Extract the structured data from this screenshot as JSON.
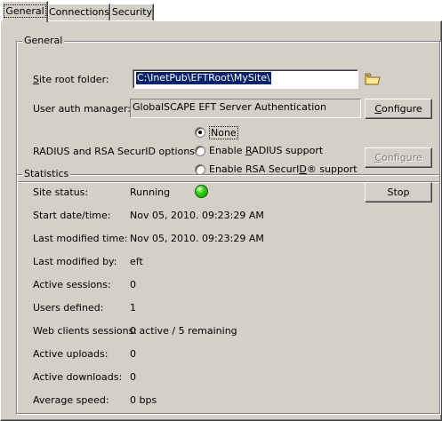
{
  "tabs": [
    {
      "label": "General",
      "active": true
    },
    {
      "label": "Connections",
      "active": false
    },
    {
      "label": "Security",
      "active": false
    }
  ],
  "general": {
    "legend": "General",
    "site_root_label": "Site root folder:",
    "site_root_value": "C:\\InetPub\\EFTRoot\\MySite\\",
    "folder_icon": "folder-icon",
    "auth_label": "User auth manager:",
    "auth_value": "GlobalSCAPE EFT Server Authentication",
    "auth_configure": "Configure",
    "radius_label": "RADIUS and RSA SecurID options:",
    "radio_options": [
      {
        "label": "None",
        "checked": true
      },
      {
        "label": "Enable RADIUS support",
        "checked": false
      },
      {
        "label": "Enable RSA SecurID® support",
        "checked": false
      }
    ],
    "radius_configure": "Configure"
  },
  "statistics": {
    "legend": "Statistics",
    "stop_button": "Stop",
    "status_light_color": "#33d11a",
    "rows": [
      {
        "label": "Site status:",
        "value": "Running"
      },
      {
        "label": "Start date/time:",
        "value": "Nov 05, 2010. 09:23:29 AM"
      },
      {
        "label": "Last modified time:",
        "value": "Nov 05, 2010. 09:23:29 AM"
      },
      {
        "label": "Last modified by:",
        "value": "eft"
      },
      {
        "label": "Active sessions:",
        "value": "0"
      },
      {
        "label": "Users defined:",
        "value": "1"
      },
      {
        "label": "Web clients sessions:",
        "value": "0 active / 5 remaining"
      },
      {
        "label": "Active uploads:",
        "value": "0"
      },
      {
        "label": "Active downloads:",
        "value": "0"
      },
      {
        "label": "Average speed:",
        "value": "0 bps"
      }
    ]
  }
}
